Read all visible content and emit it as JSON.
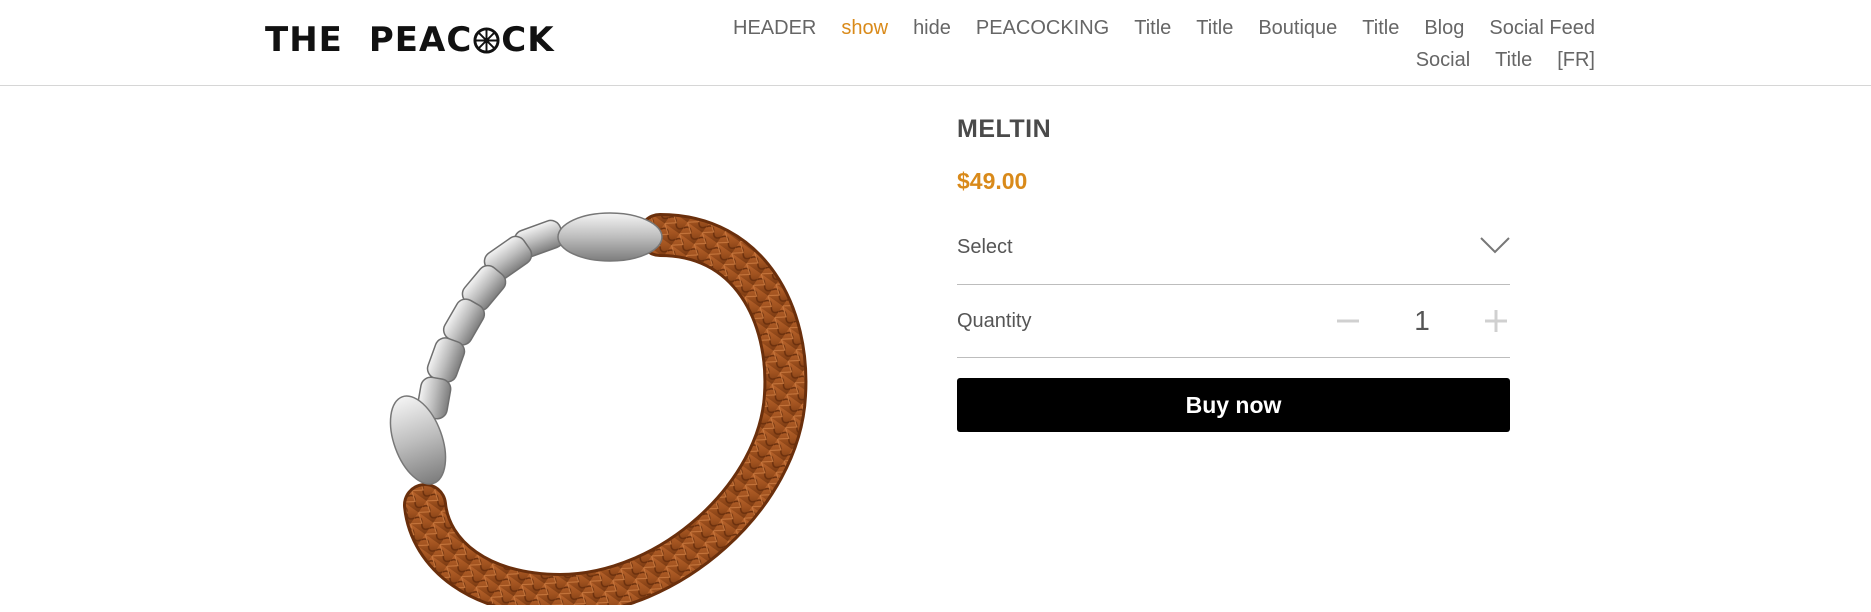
{
  "brand": {
    "logo_part1": "THE",
    "logo_part2": "PEA",
    "logo_part3": "C",
    "logo_part4": "CK"
  },
  "nav": {
    "items": [
      {
        "label": "HEADER",
        "active": false
      },
      {
        "label": "show",
        "active": true
      },
      {
        "label": "hide",
        "active": false
      },
      {
        "label": "PEACOCKING",
        "active": false
      },
      {
        "label": "Title",
        "active": false
      },
      {
        "label": "Title",
        "active": false
      },
      {
        "label": "Boutique",
        "active": false
      },
      {
        "label": "Title",
        "active": false
      },
      {
        "label": "Blog",
        "active": false
      },
      {
        "label": "Social Feed",
        "active": false
      },
      {
        "label": "Social",
        "active": false
      },
      {
        "label": "Title",
        "active": false
      },
      {
        "label": "[FR]",
        "active": false
      }
    ],
    "accent_color": "#d98a1a"
  },
  "product": {
    "name": "MELTIN",
    "price": "$49.00",
    "image_icon": "leather-bracelet-image"
  },
  "variant": {
    "select_label": "Select",
    "icon": "chevron-down-icon"
  },
  "quantity": {
    "label": "Quantity",
    "value": "1",
    "minus_icon": "minus-icon",
    "plus_icon": "plus-icon"
  },
  "cta": {
    "buy_label": "Buy now",
    "color": "#000000"
  }
}
